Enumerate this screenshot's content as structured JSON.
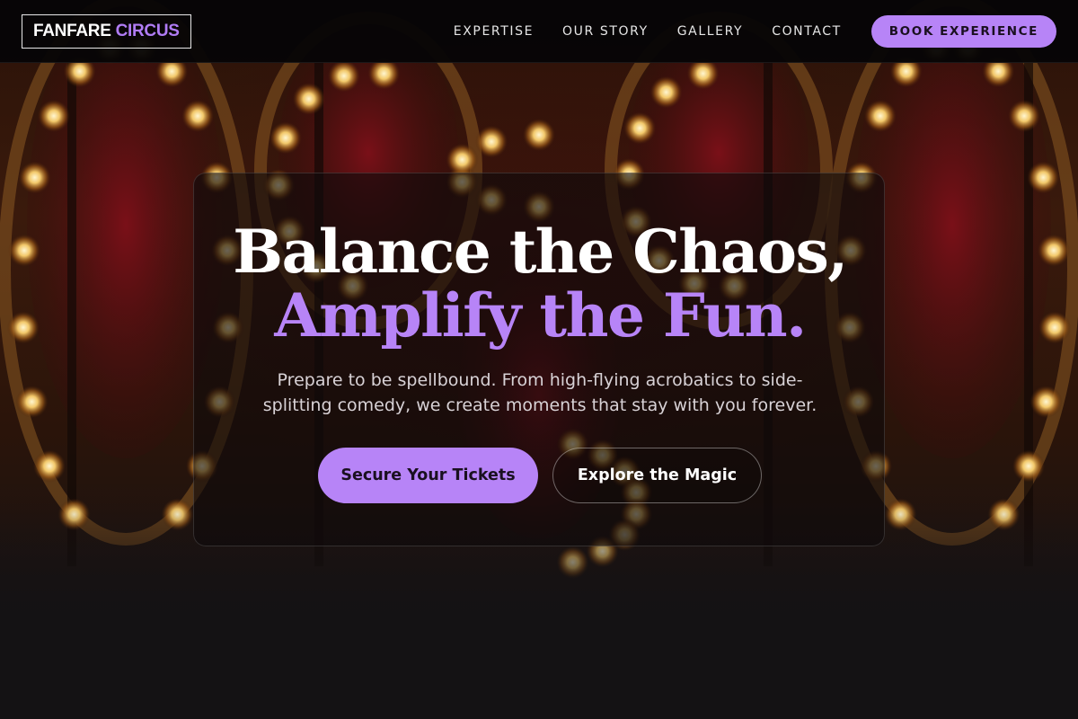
{
  "brand": {
    "word1": "FANFARE",
    "word2": "CIRCUS"
  },
  "nav": {
    "links": [
      "EXPERTISE",
      "OUR STORY",
      "GALLERY",
      "CONTACT"
    ],
    "cta_label": "BOOK EXPERIENCE"
  },
  "hero": {
    "headline_line1": "Balance the Chaos,",
    "headline_line2": "Amplify the Fun.",
    "subtitle": "Prepare to be spellbound. From high-flying acrobatics to side-splitting comedy, we create moments that stay with you forever.",
    "primary_button": "Secure Your Tickets",
    "secondary_button": "Explore the Magic",
    "background_image": "carousel-lights-photo"
  },
  "colors": {
    "accent": "#b784f7",
    "nav_bg": "#060506",
    "page_bg": "#141214"
  }
}
